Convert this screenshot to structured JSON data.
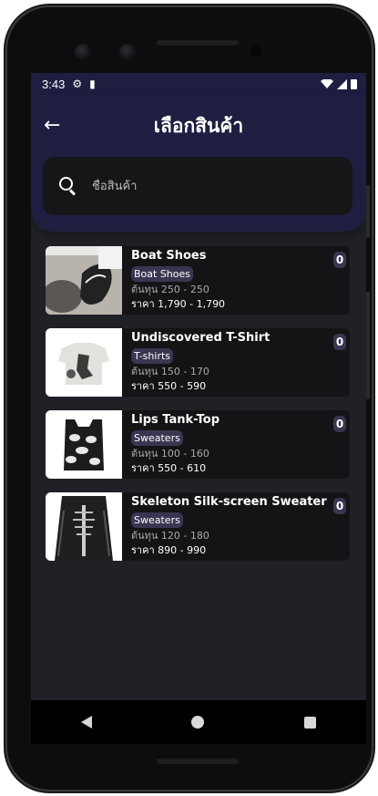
{
  "status_bar": {
    "time": "3:43",
    "icons": [
      "gear-icon",
      "sd-card-icon",
      "wifi-icon",
      "signal-icon",
      "battery-icon"
    ]
  },
  "header": {
    "title": "เลือกสินค้า",
    "back_icon": "arrow-left-icon"
  },
  "search": {
    "placeholder": "ชื่อสินค้า",
    "value": ""
  },
  "products": [
    {
      "name": "Boat Shoes",
      "category": "Boat Shoes",
      "cost": "ต้นทุน 250 - 250",
      "price": "ราคา 1,790 - 1,790",
      "qty": "0"
    },
    {
      "name": "Undiscovered T-Shirt",
      "category": "T-shirts",
      "cost": "ต้นทุน 150 - 170",
      "price": "ราคา 550 - 590",
      "qty": "0"
    },
    {
      "name": "Lips Tank-Top",
      "category": "Sweaters",
      "cost": "ต้นทุน 100 - 160",
      "price": "ราคา 550 - 610",
      "qty": "0"
    },
    {
      "name": "Skeleton Silk-screen Sweater",
      "category": "Sweaters",
      "cost": "ต้นทุน 120 - 180",
      "price": "ราคา 890 - 990",
      "qty": "0"
    }
  ],
  "nav": {
    "icons": [
      "nav-back-icon",
      "nav-home-icon",
      "nav-recents-icon"
    ]
  },
  "colors": {
    "header_bg": "#1d1e40",
    "screen_bg": "#202126",
    "card_bg": "#141416",
    "badge_bg": "#3a3550"
  }
}
